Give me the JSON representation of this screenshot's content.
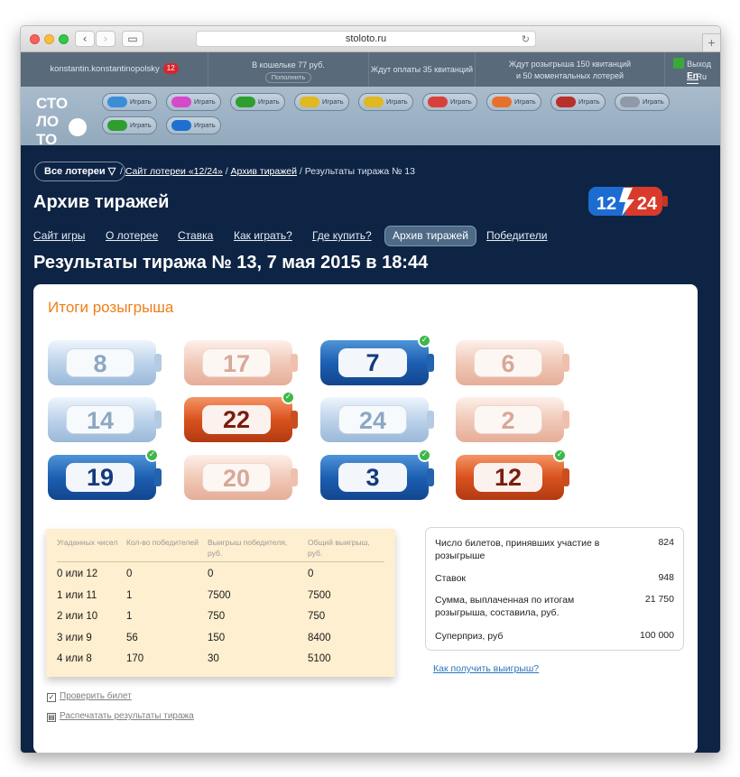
{
  "browser": {
    "url": "stoloto.ru"
  },
  "topbar": {
    "username": "konstantin.konstantinopolsky",
    "badge_count": "12",
    "wallet_text": "В кошельке 77 руб.",
    "topup_label": "Пополнить",
    "await_payment": "Ждут оплаты 35 квитанций",
    "await_draw_line1": "Ждут розыгрыша 150 квитанций",
    "await_draw_line2": "и 50 моментальных лотерей",
    "exit_label": "Выход",
    "lang_ru": "Ru",
    "lang_en": "En"
  },
  "logo": {
    "line1": "СТО",
    "line2": "ЛО",
    "line3": "ТО"
  },
  "lotteries": {
    "play_label": "Играть",
    "items": [
      {
        "name": "lottery-1",
        "color": "#3a8ed8"
      },
      {
        "name": "lottery-2",
        "color": "#d44ac9"
      },
      {
        "name": "keno",
        "color": "#2f9e2f"
      },
      {
        "name": "lottery-4",
        "color": "#e0b820"
      },
      {
        "name": "lottery-5",
        "color": "#e0b820"
      },
      {
        "name": "lottery-6",
        "color": "#d8403a"
      },
      {
        "name": "lottery-7",
        "color": "#e8702a"
      },
      {
        "name": "lottery-8",
        "color": "#b8302a"
      },
      {
        "name": "lottery-9",
        "color": "#8e9aa8"
      },
      {
        "name": "lottery-10",
        "color": "#2f9e2f"
      },
      {
        "name": "12-24",
        "color": "#1e6fd0"
      }
    ]
  },
  "nav": {
    "all_lotteries": "Все лотереи",
    "breadcrumb_sep": "/",
    "crumb1": "Сайт лотереи «12/24»",
    "crumb2": "Архив тиражей",
    "crumb3": "Результаты тиража № 13"
  },
  "page": {
    "title": "Архив тиражей",
    "game_logo_left": "12",
    "game_logo_right": "24",
    "tabs": [
      "Сайт игры",
      "О лотерее",
      "Ставка",
      "Как играть?",
      "Где купить?",
      "Архив тиражей",
      "Победители"
    ],
    "active_tab": "Архив тиражей",
    "result_title": "Результаты тиража № 13, 7 мая 2015 в 18:44"
  },
  "results": {
    "heading": "Итоги розыгрыша",
    "balls": [
      {
        "n": "8",
        "style": "lb",
        "won": false
      },
      {
        "n": "17",
        "style": "lp",
        "won": false
      },
      {
        "n": "7",
        "style": "db",
        "won": true
      },
      {
        "n": "6",
        "style": "lp",
        "won": false
      },
      {
        "n": "14",
        "style": "lb",
        "won": false
      },
      {
        "n": "22",
        "style": "dr",
        "won": true
      },
      {
        "n": "24",
        "style": "lb",
        "won": false
      },
      {
        "n": "2",
        "style": "lp",
        "won": false
      },
      {
        "n": "19",
        "style": "db",
        "won": true
      },
      {
        "n": "20",
        "style": "lp",
        "won": false
      },
      {
        "n": "3",
        "style": "db",
        "won": true
      },
      {
        "n": "12",
        "style": "dr",
        "won": true
      }
    ]
  },
  "win_table": {
    "headers": [
      "Угаданных чисел",
      "Кол-во победителей",
      "Выигрыш победителя, руб.",
      "Общий выигрыш, руб."
    ],
    "rows": [
      [
        "0 или 12",
        "0",
        "0",
        "0"
      ],
      [
        "1 или 11",
        "1",
        "7500",
        "7500"
      ],
      [
        "2 или 10",
        "1",
        "750",
        "750"
      ],
      [
        "3 или 9",
        "56",
        "150",
        "8400"
      ],
      [
        "4 или 8",
        "170",
        "30",
        "5100"
      ]
    ]
  },
  "stats": {
    "tickets_label": "Число билетов, принявших участие в розыгрыше",
    "tickets_value": "824",
    "bets_label": "Ставок",
    "bets_value": "948",
    "paid_label": "Сумма, выплаченная по итогам розыгрыша, составила, руб.",
    "paid_value": "21 750",
    "superprize_label": "Суперприз, руб",
    "superprize_value": "100 000"
  },
  "links": {
    "how_to_get": "Как получить выигрыш?",
    "check_ticket": "Проверить билет",
    "print_results": "Распечатать результаты тиража"
  }
}
